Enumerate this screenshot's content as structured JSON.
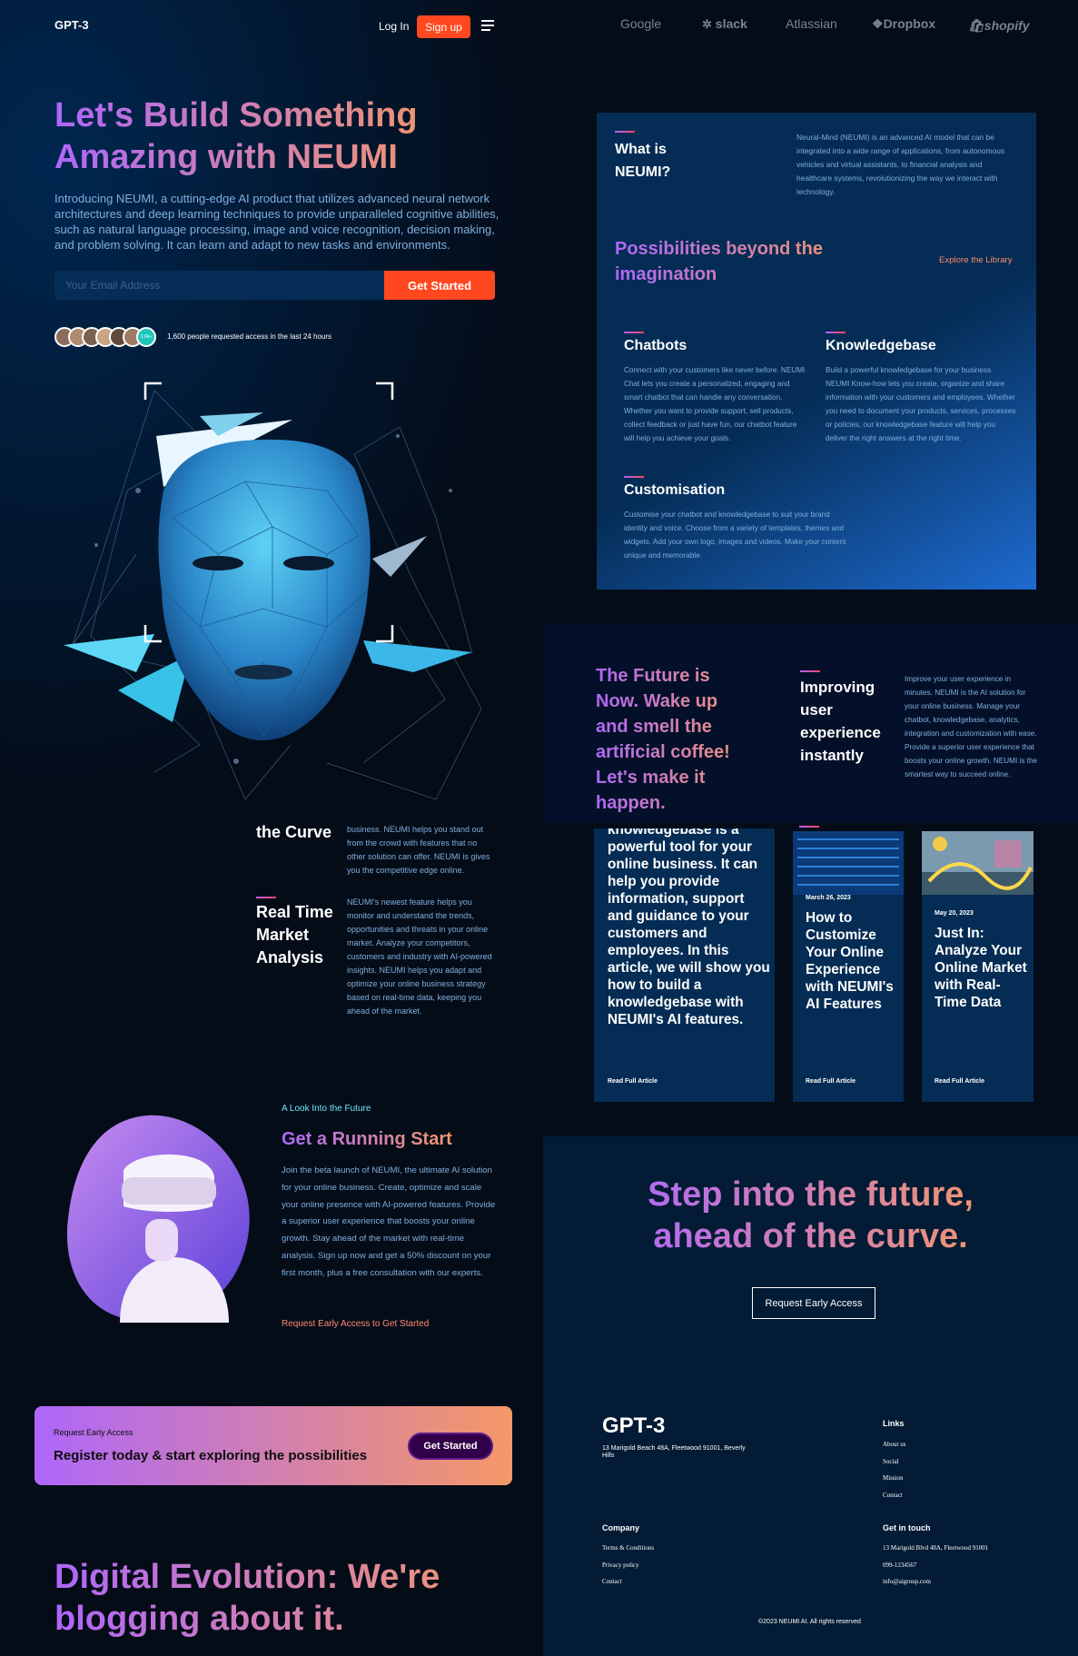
{
  "hero": {
    "logo": "GPT-3",
    "nav": {
      "login": "Log In",
      "signup": "Sign up"
    },
    "title": "Let's Build Something Amazing with NEUMI",
    "intro": "Introducing NEUMI, a cutting-edge AI product that utilizes advanced neural network architectures and deep learning techniques to provide unparalleled cognitive abilities, such as natural language processing, image and voice recognition, decision making, and problem solving. It can learn and adapt to new tasks and environments.",
    "email_placeholder": "Your Email Address",
    "cta": "Get Started",
    "avatar_count": "1.6k+",
    "people_note": "1,600 people requested access in the last 24 hours"
  },
  "brands": [
    "Google",
    "slack",
    "Atlassian",
    "Dropbox",
    "shopify"
  ],
  "whatis": {
    "title": "What is NEUMI?",
    "description": "Neural-Mind (NEUMI) is an advanced AI model that can be integrated into a wide range of applications, from autonomous vehicles and virtual assistants, to financial analysis and healthcare systems, revolutionizing the way we interact with technology.",
    "headline": "Possibilities beyond the imagination",
    "explore": "Explore the Library",
    "features": [
      {
        "title": "Chatbots",
        "text": "Connect with your customers like never before. NEUMI Chat lets you create a personalized, engaging and smart chatbot that can handle any conversation. Whether you want to provide support, sell products, collect feedback or just have fun, our chatbot feature will help you achieve your goals."
      },
      {
        "title": "Knowledgebase",
        "text": "Build a powerful knowledgebase for your business. NEUMI Know-how lets you create, organize and share information with your customers and employees. Whether you need to document your products, services, processes or policies, our knowledgebase feature will help you deliver the right answers at the right time."
      },
      {
        "title": "Customisation",
        "text": "Customise your chatbot and knowledgebase to suit your brand identity and voice. Choose from a variety of templates, themes and widgets. Add your own logo, images and videos. Make your content unique and memorable."
      }
    ]
  },
  "future": {
    "headline": "The Future is Now. Wake up and smell the artificial coffee! Let's make it happen.",
    "feature_title": "Improving user experience instantly",
    "feature_text": "Improve your user experience in minutes. NEUMI is the AI solution for your online business. Manage your chatbot, knowledgebase, analytics, integration and customization with ease. Provide a superior user experience that boosts your online growth. NEUMI is the smartest way to succeed online."
  },
  "left_features": [
    {
      "title": "the Curve",
      "text": "business. NEUMI helps you stand out from the crowd with features that no other solution can offer. NEUMI is gives you the competitive edge online."
    },
    {
      "title": "Real Time Market Analysis",
      "text": "NEUMI's newest feature helps you monitor and understand the trends, opportunities and threats in your online market. Analyze your competitors, customers and industry with AI-powered insights. NEUMI helps you adapt and optimize your online business strategy based on real-time data, keeping you ahead of the market."
    }
  ],
  "running": {
    "eyebrow": "A Look Into the Future",
    "title": "Get a Running Start",
    "text": "Join the beta launch of NEUMI, the ultimate AI solution for your online business. Create, optimize and scale your online presence with AI-powered features. Provide a superior user experience that boosts your online growth. Stay ahead of the market with real-time analysis. Sign up now and get a 50% discount on your first month, plus a free consultation with our experts.",
    "link": "Request Early Access to Get Started"
  },
  "cta_card": {
    "small": "Request Early Access",
    "big": "Register today & start exploring the possibilities",
    "button": "Get Started"
  },
  "blog": {
    "title": "Digital Evolution: We're blogging about it."
  },
  "articles": [
    {
      "title": "knowledgebase is a powerful tool for your online business. It can help you provide information, support and guidance to your customers and employees. In this article, we will show you how to build a knowledgebase with NEUMI's AI features.",
      "read": "Read Full Article"
    },
    {
      "date": "March 26, 2023",
      "title": "How to Customize Your Online Experience with NEUMI's AI Features",
      "read": "Read Full Article"
    },
    {
      "date": "May 20, 2023",
      "title": "Just In: Analyze Your Online Market with Real-Time Data",
      "read": "Read Full Article"
    }
  ],
  "step": {
    "title": "Step into the future, ahead of the curve.",
    "button": "Request Early Access"
  },
  "footer": {
    "logo": "GPT-3",
    "address": "13 Marigold Beach 48A, Fleetwood 91001, Beverly Hills",
    "links_title": "Links",
    "links": [
      "About us",
      "Social",
      "Mission",
      "Contact"
    ],
    "company_title": "Company",
    "company": [
      "Terms & Conditions",
      "Privacy policy",
      "Contact"
    ],
    "touch_title": "Get in touch",
    "touch": [
      "13 Marigold Blvd 48A, Fleetwood 91001",
      "099-1234567",
      "info@aigroup.com"
    ],
    "copyright": "©2023 NEUMI AI. All rights reserved"
  },
  "colors": {
    "accent": "#ff4820",
    "gradient_start": "#ae67fa",
    "gradient_end": "#f49867",
    "card": "#042c54"
  }
}
